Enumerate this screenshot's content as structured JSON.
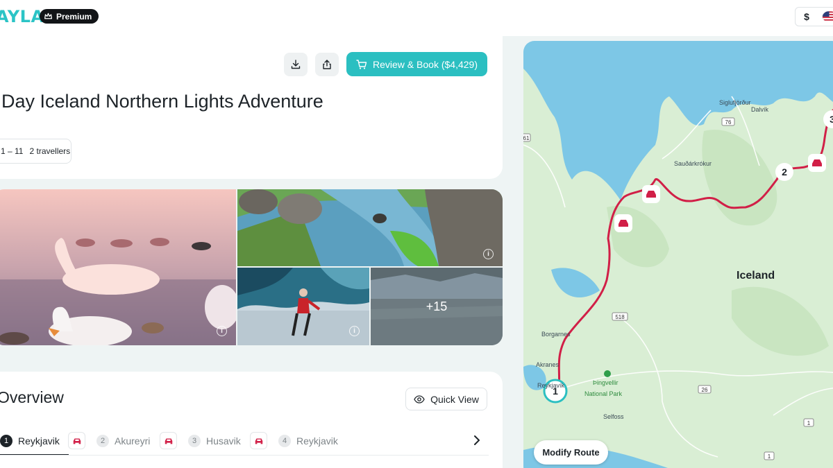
{
  "header": {
    "logo_text": "AYLA",
    "premium_label": "Premium",
    "currency": "$",
    "flag_icon": "us-flag-icon"
  },
  "trip": {
    "title": "Day Iceland Northern Lights Adventure",
    "dates": "1 – 11",
    "travellers": "2 travellers",
    "book_label": "Review & Book ($4,429)",
    "download_icon": "download-icon",
    "share_icon": "share-icon"
  },
  "gallery": {
    "more_count": "+15"
  },
  "overview": {
    "title": "Overview",
    "quick_view_label": "Quick View",
    "stops": [
      {
        "num": "1",
        "name": "Reykjavik"
      },
      {
        "num": "2",
        "name": "Akureyri"
      },
      {
        "num": "3",
        "name": "Husavik"
      },
      {
        "num": "4",
        "name": "Reykjavik"
      }
    ]
  },
  "map": {
    "country_label": "Iceland",
    "places": [
      "Siglufjörður",
      "Dalvík",
      "Sauðárkrókur",
      "Borgarnes",
      "Akranes",
      "Reykjavík",
      "Þingvellir",
      "National Park",
      "Selfoss"
    ],
    "road_numbers": [
      "76",
      "518",
      "26",
      "1",
      "1",
      "61"
    ],
    "route_markers": [
      "1",
      "2",
      "3"
    ],
    "modify_route_label": "Modify Route",
    "colors": {
      "water": "#7dc7e6",
      "land": "#d9eed4",
      "route": "#d11f47",
      "marker": "#2bbfc1"
    }
  },
  "colors": {
    "accent": "#2bbfc1",
    "dark": "#1d2328"
  }
}
